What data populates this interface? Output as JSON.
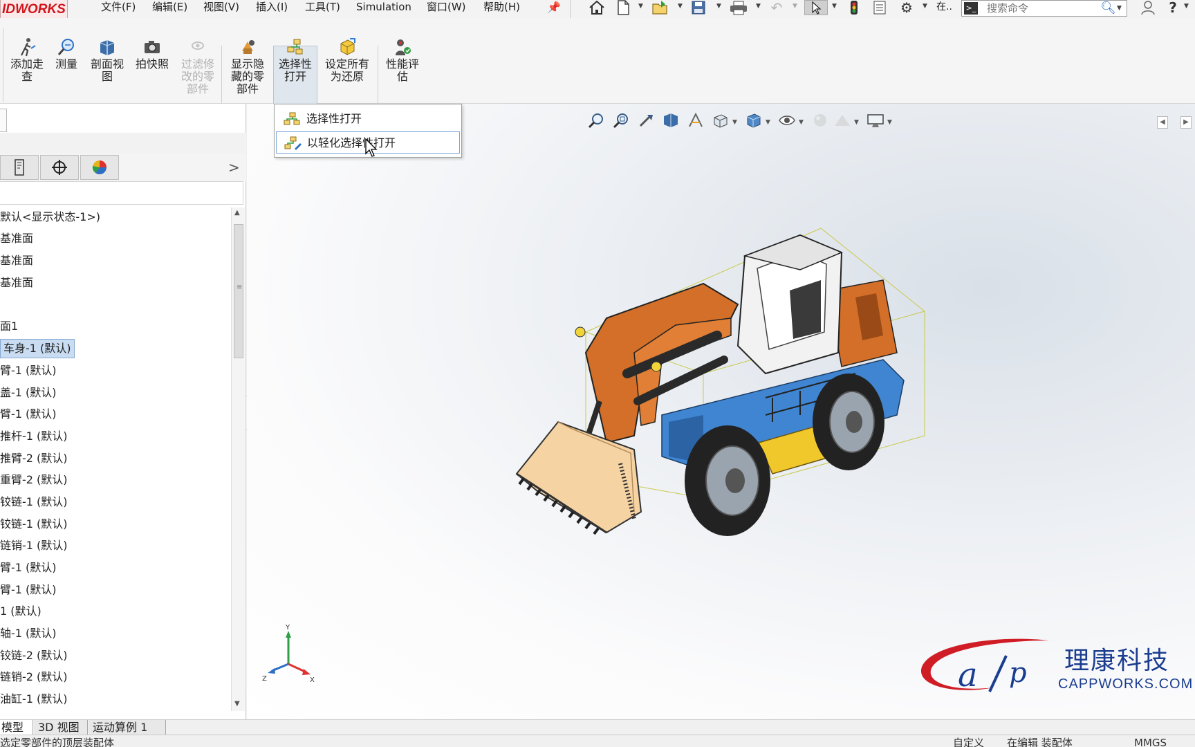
{
  "app": {
    "logo_text": "IDWORKS",
    "menus": [
      "文件(F)",
      "编辑(E)",
      "视图(V)",
      "插入(I)",
      "工具(T)",
      "Simulation",
      "窗口(W)",
      "帮助(H)"
    ],
    "quick_access_truncated": "在..",
    "search_placeholder": "搜索命令"
  },
  "ribbon": {
    "buttons": [
      {
        "label": "添加走\n查",
        "icon": "walkthrough-icon"
      },
      {
        "label": "测量",
        "icon": "measure-icon"
      },
      {
        "label": "剖面视\n图",
        "icon": "section-view-icon"
      },
      {
        "label": "拍快照",
        "icon": "camera-icon"
      },
      {
        "label": "过滤修\n改的零\n部件",
        "icon": "filter-modified-icon",
        "disabled": true
      },
      {
        "label": "显示隐\n藏的零\n部件",
        "icon": "show-hidden-icon"
      },
      {
        "label": "选择性\n打开",
        "icon": "selective-open-icon"
      },
      {
        "label": "设定所有\n为还原",
        "icon": "set-resolved-icon"
      },
      {
        "label": "性能评\n估",
        "icon": "performance-eval-icon"
      }
    ]
  },
  "dropdown": {
    "items": [
      "选择性打开",
      "以轻化选择性打开"
    ],
    "hovered_index": 1
  },
  "tree": {
    "items": [
      "默认<显示状态-1>)",
      "基准面",
      "基准面",
      "基准面",
      "",
      "面1",
      "车身-1 (默认)",
      "臂-1 (默认)",
      "盖-1 (默认)",
      "臂-1 (默认)",
      "推杆-1 (默认)",
      "推臂-2 (默认)",
      "重臂-2 (默认)",
      "铰链-1 (默认)",
      "铰链-1 (默认)",
      "链销-1 (默认)",
      "臂-1 (默认)",
      "臂-1 (默认)",
      "1 (默认)",
      "轴-1 (默认)",
      "铰链-2 (默认)",
      "链销-2 (默认)",
      "油缸-1 (默认)"
    ],
    "selected_index": 6
  },
  "triad": {
    "x": "X",
    "y": "Y",
    "z": "Z"
  },
  "watermark": {
    "cn": "理康科技",
    "en": "CAPPWORKS.COM"
  },
  "bottom_tabs": [
    "模型",
    "3D 视图",
    "运动算例 1"
  ],
  "active_tab_index": 0,
  "status": {
    "left": "选定零部件的顶层装配体",
    "custom": "自定义",
    "editing": "在编辑 装配体",
    "units": "MMGS"
  },
  "colors": {
    "logo_red": "#d0161d",
    "selection_blue": "#c9dcf2",
    "watermark_red": "#d01d25",
    "watermark_blue": "#1b3d8f",
    "loader_orange": "#d36f28",
    "loader_blue": "#3f85d1",
    "loader_yellow": "#f1c82b"
  }
}
